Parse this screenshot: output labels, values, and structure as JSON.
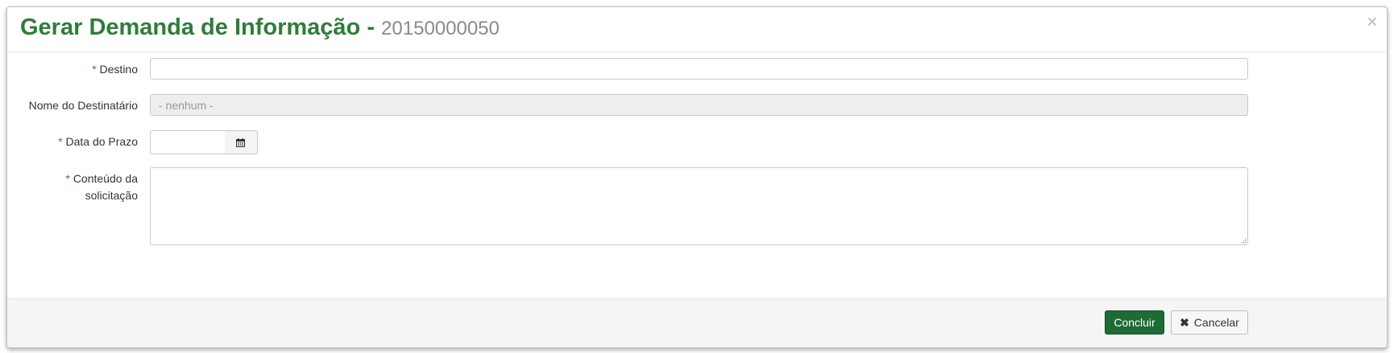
{
  "modal": {
    "title": "Gerar Demanda de Informação",
    "title_separator": " - ",
    "title_number": "20150000050",
    "close_glyph": "×"
  },
  "form": {
    "required_marker": "*",
    "destino": {
      "label": "Destino",
      "value": ""
    },
    "nome_destinatario": {
      "label": "Nome do Destinatário",
      "value": "- nenhum -"
    },
    "data_prazo": {
      "label": "Data do Prazo",
      "value": "",
      "button_icon": "calendar-icon"
    },
    "conteudo": {
      "label_line1": "Conteúdo da",
      "label_line2": "solicitação",
      "value": ""
    }
  },
  "footer": {
    "concluir_label": "Concluir",
    "cancelar_icon": "✖",
    "cancelar_label": "Cancelar"
  },
  "colors": {
    "title_green": "#2e7d3a",
    "primary_button": "#1e6b35",
    "required_asterisk": "#2e8b3a"
  }
}
